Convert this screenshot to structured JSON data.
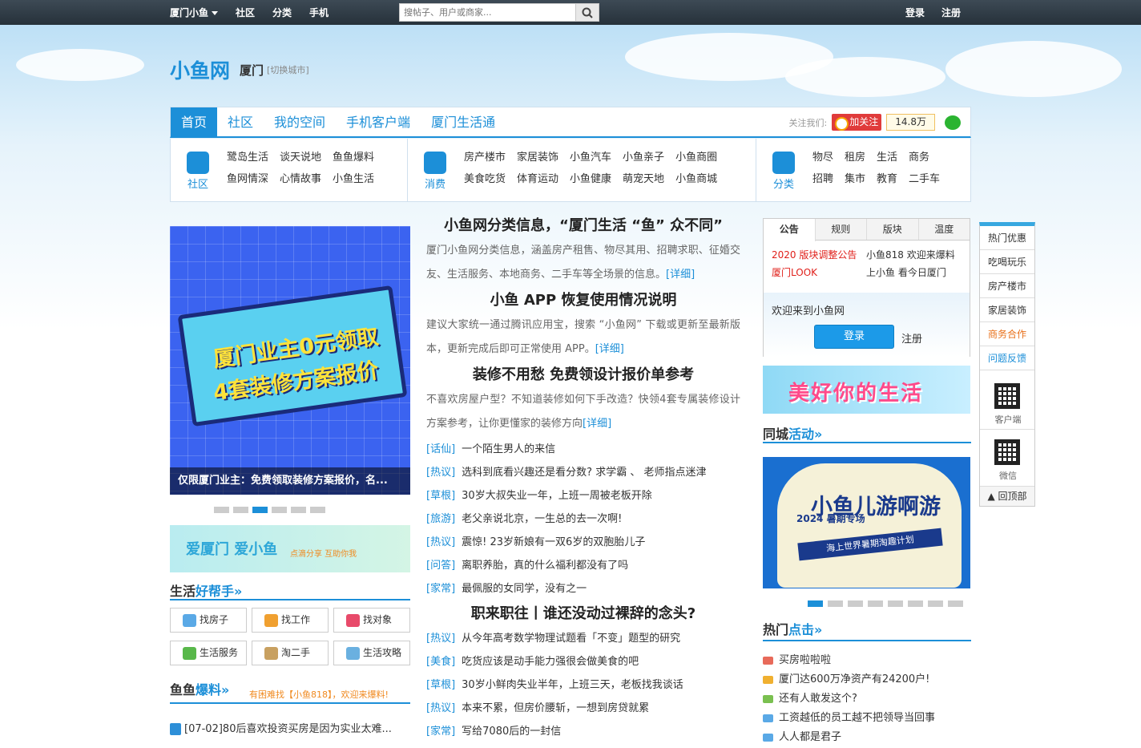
{
  "topbar": {
    "site": "厦门小鱼",
    "links": [
      "社区",
      "分类",
      "手机"
    ],
    "search_placeholder": "搜帖子、用户或商家...",
    "login": "登录",
    "register": "注册"
  },
  "logo": {
    "text": "小鱼网",
    "city": "厦门",
    "switch": "[切换城市]"
  },
  "nav": {
    "tabs": [
      "首页",
      "社区",
      "我的空间",
      "手机客户端",
      "厦门生活通"
    ],
    "follow_label": "关注我们:",
    "weibo": "加关注",
    "fans": "14.8万"
  },
  "categories": [
    {
      "label": "社区",
      "items": [
        "鹭岛生活",
        "谈天说地",
        "鱼鱼爆料",
        "鱼网情深",
        "心情故事",
        "小鱼生活"
      ]
    },
    {
      "label": "消费",
      "items": [
        "房产楼市",
        "家居装饰",
        "小鱼汽车",
        "小鱼亲子",
        "小鱼商圈",
        "美食吃货",
        "体育运动",
        "小鱼健康",
        "萌宠天地",
        "小鱼商城"
      ]
    },
    {
      "label": "分类",
      "items": [
        "物尽",
        "租房",
        "生活",
        "商务",
        "招聘",
        "集市",
        "教育",
        "二手车"
      ]
    }
  ],
  "banner": {
    "line1": "厦门业主0元领取",
    "line2": "4套装修方案报价",
    "caption": "仅限厦门业主：免费领取装修方案报价，名..."
  },
  "love_banner": {
    "title": "爱厦门 爱小鱼",
    "sub": "点滴分享 互助你我"
  },
  "helper": {
    "title": "生活",
    "title_em": "好帮手»",
    "items": [
      {
        "label": "找房子",
        "color": "#5aa9e6"
      },
      {
        "label": "找工作",
        "color": "#f0a030"
      },
      {
        "label": "找对象",
        "color": "#e84a6a"
      },
      {
        "label": "生活服务",
        "color": "#58b84a"
      },
      {
        "label": "淘二手",
        "color": "#c8a060"
      },
      {
        "label": "生活攻略",
        "color": "#6ab0e0"
      }
    ]
  },
  "baoliao": {
    "title": "鱼鱼",
    "title_em": "爆料»",
    "note": "有困难找【小鱼818】，欢迎来爆料!",
    "first": "[07-02]80后喜欢投资买房是因为实业太难..."
  },
  "news": {
    "headline1": "小鱼网分类信息，“厦门生活 “鱼” 众不同”",
    "desc1": "厦门小鱼网分类信息，涵盖房产租售、物尽其用、招聘求职、征婚交友、生活服务、本地商务、二手车等全场景的信息。",
    "detail": "[详细]",
    "headline2": "小鱼 APP 恢复使用情况说明",
    "desc2": "建议大家统一通过腾讯应用宝，搜索 “小鱼网” 下载或更新至最新版本，更新完成后即可正常使用 APP。",
    "headline3": "装修不用愁 免费领设计报价单参考",
    "desc3": "不喜欢房屋户型？不知道装修如何下手改造？快领4套专属装修设计方案参考，让你更懂家的装修方向",
    "list1": [
      {
        "tag": "[话仙]",
        "title": "一个陌生男人的来信"
      },
      {
        "tag": "[热议]",
        "title": "选科到底看兴趣还是看分数? 求学霸 、 老师指点迷津"
      },
      {
        "tag": "[草根]",
        "title": "30岁大叔失业一年，上班一周被老板开除"
      },
      {
        "tag": "[旅游]",
        "title": "老父亲说北京，一生总的去一次啊!"
      },
      {
        "tag": "[热议]",
        "title": "震惊! 23岁新娘有一双6岁的双胞胎儿子"
      },
      {
        "tag": "[问答]",
        "title": "离职养胎，真的什么福利都没有了吗"
      },
      {
        "tag": "[家常]",
        "title": "最佩服的女同学，没有之一"
      }
    ],
    "headline4": "职来职往丨谁还没动过裸辞的念头?",
    "list2": [
      {
        "tag": "[热议]",
        "title": "从今年高考数学物理试题看「不变」题型的研究"
      },
      {
        "tag": "[美食]",
        "title": "吃货应该是动手能力强很会做美食的吧"
      },
      {
        "tag": "[草根]",
        "title": "30岁小鲜肉失业半年，上班三天，老板找我谈话"
      },
      {
        "tag": "[热议]",
        "title": "本来不累，但房价腰斩，一想到房贷就累"
      },
      {
        "tag": "[家常]",
        "title": "写给7080后的一封信"
      }
    ]
  },
  "notice": {
    "tabs": [
      "公告",
      "规则",
      "版块",
      "温度"
    ],
    "items": [
      {
        "text": "2020 版块调整公告",
        "red": true
      },
      {
        "text": "小鱼818 欢迎来爆料",
        "red": false
      },
      {
        "text": "厦门LOOK",
        "red": true
      },
      {
        "text": "上小鱼 看今日厦门",
        "red": false
      }
    ],
    "welcome": "欢迎来到小鱼网",
    "login": "登录",
    "register": "注册"
  },
  "life_banner": {
    "title": "美好你的生活"
  },
  "activity": {
    "title": "同城",
    "title_em": "活动»",
    "poster_title": "小鱼儿游啊游",
    "poster_year": "2024 暑期专场",
    "poster_sub": "海上世界暑期淘趣计划"
  },
  "hot": {
    "title": "热门",
    "title_em": "点击»",
    "items": [
      {
        "text": "买房啦啦啦",
        "color": "#e86a5a"
      },
      {
        "text": "厦门达600万净资产有24200户!",
        "color": "#f0b030"
      },
      {
        "text": "还有人敢发这个?",
        "color": "#7ac050"
      },
      {
        "text": "工资越低的员工越不把领导当回事",
        "color": "#5aa9e6"
      },
      {
        "text": "人人都是君子",
        "color": "#5aa9e6"
      }
    ]
  },
  "float": {
    "items": [
      "热门优惠",
      "吃喝玩乐",
      "房产楼市",
      "家居装饰",
      "商务合作",
      "问题反馈"
    ],
    "client": "客户端",
    "wechat": "微信",
    "top": "回顶部"
  }
}
